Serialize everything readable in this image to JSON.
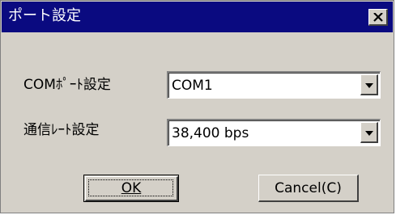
{
  "window": {
    "title": "ポート設定",
    "close_icon": "close-icon"
  },
  "form": {
    "com_port": {
      "label": "COMﾎﾟｰﾄ設定",
      "value": "COM1",
      "dropdown_icon": "chevron-down-icon"
    },
    "baud_rate": {
      "label": "通信ﾚｰﾄ設定",
      "value": "38,400 bps",
      "dropdown_icon": "chevron-down-icon"
    }
  },
  "buttons": {
    "ok_label": "OK",
    "cancel_label": "Cancel(C)"
  },
  "colors": {
    "titlebar": "#0a0a80",
    "face": "#d4d0c8"
  }
}
